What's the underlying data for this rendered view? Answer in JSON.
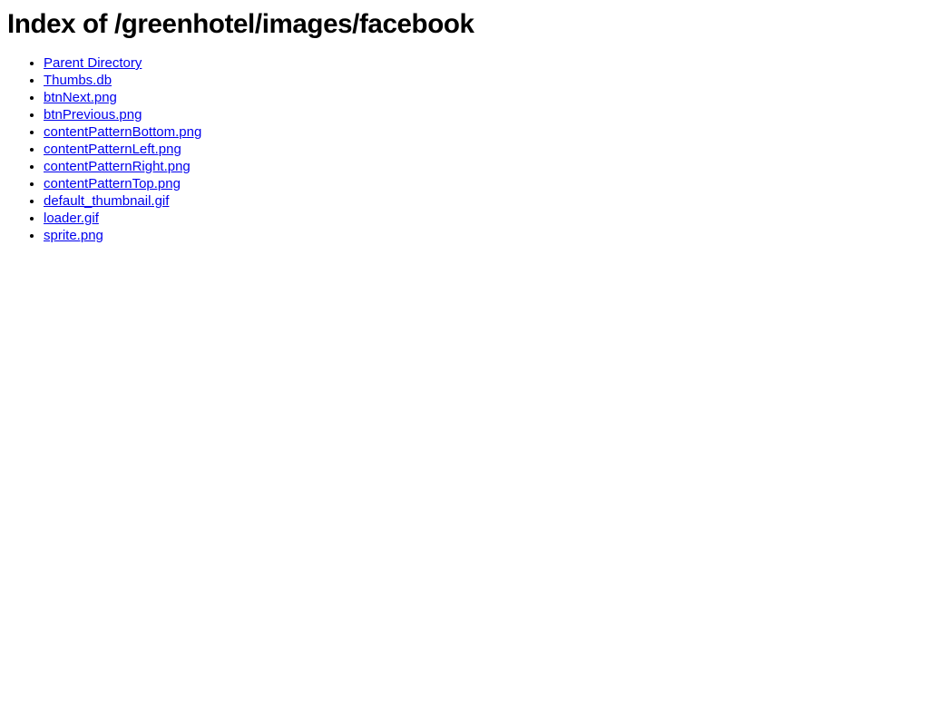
{
  "page": {
    "title": "Index of /greenhotel/images/facebook",
    "background_color": "#ffffff",
    "text_color": "#000000",
    "link_color": "#0000ee"
  },
  "listing": {
    "items": [
      {
        "label": "Parent Directory"
      },
      {
        "label": "Thumbs.db"
      },
      {
        "label": "btnNext.png"
      },
      {
        "label": "btnPrevious.png"
      },
      {
        "label": "contentPatternBottom.png"
      },
      {
        "label": "contentPatternLeft.png"
      },
      {
        "label": "contentPatternRight.png"
      },
      {
        "label": "contentPatternTop.png"
      },
      {
        "label": "default_thumbnail.gif"
      },
      {
        "label": "loader.gif"
      },
      {
        "label": "sprite.png"
      }
    ]
  }
}
